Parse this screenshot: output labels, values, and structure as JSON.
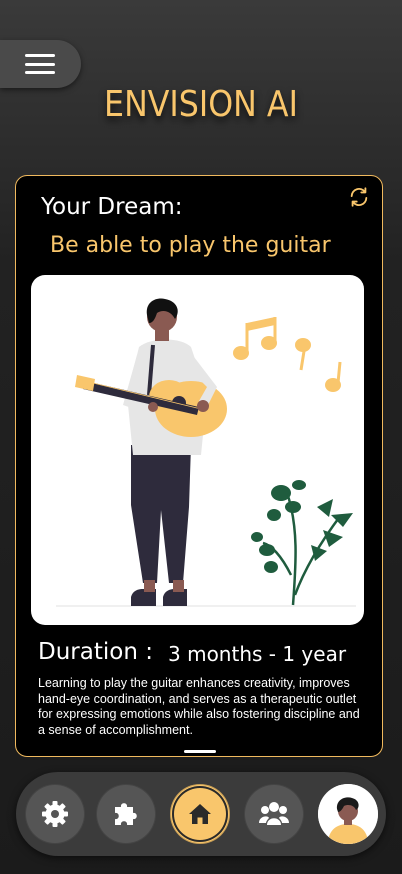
{
  "header": {
    "title": "ENVISION AI"
  },
  "dream": {
    "label": "Your Dream:",
    "text": "Be able to play the guitar"
  },
  "duration": {
    "label": "Duration :",
    "value": "3 months - 1 year"
  },
  "description": "Learning to play the guitar enhances creativity, improves hand-eye coordination, and serves as a therapeutic outlet for expressing emotions while also fostering discipline and a sense of accomplishment.",
  "icons": {
    "menu": "hamburger-menu-icon",
    "refresh": "refresh-icon",
    "illustration": "person-playing-guitar-illustration",
    "nav": [
      "gear-icon",
      "puzzle-icon",
      "home-icon",
      "group-icon",
      "avatar"
    ]
  },
  "nav": {
    "active": "home"
  },
  "colors": {
    "accent": "#f9c66c",
    "card_border": "#f0b95e",
    "background": "#1b1b1b",
    "nav_bg": "#3b3b3b",
    "nav_button": "#555555"
  }
}
